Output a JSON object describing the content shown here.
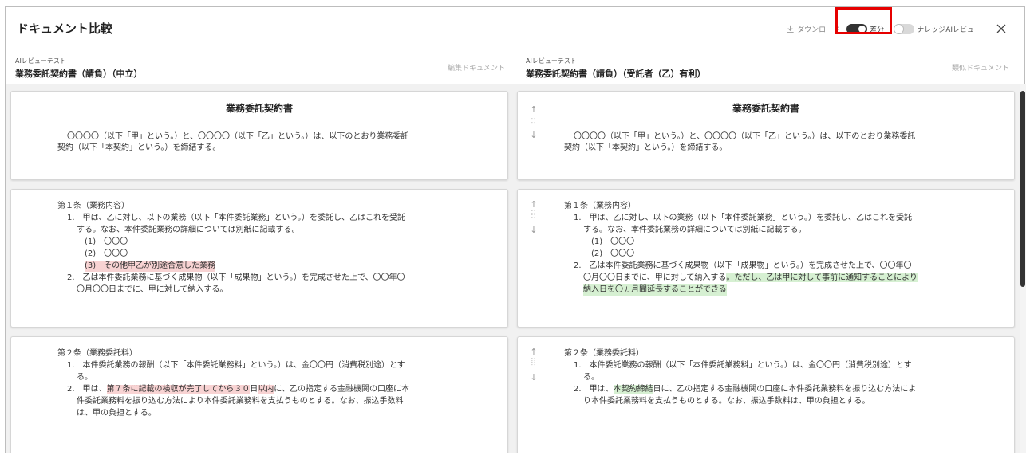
{
  "window": {
    "title": "ドキュメント比較"
  },
  "toolbar": {
    "download_label": "ダウンロード",
    "diff_label": "差分",
    "knowledge_label": "ナレッジAIレビュー",
    "diff_on": true,
    "knowledge_on": false
  },
  "left_doc": {
    "review_label": "AIレビューテスト",
    "name": "業務委託契約書（請負）（中立）",
    "tag": "編集ドキュメント"
  },
  "right_doc": {
    "review_label": "AIレビューテスト",
    "name": "業務委託契約書（請負）（受託者（乙）有利）",
    "tag": "類似ドキュメント"
  },
  "sections": {
    "s1": {
      "title": "業務委託契約書",
      "left_lines": [
        "〇〇〇〇（以下「甲」という。）と、〇〇〇〇（以下「乙」という。）は、以下のとおり業務委託",
        "契約（以下「本契約」という。）を締結する。"
      ],
      "right_lines": [
        "〇〇〇〇（以下「甲」という。）と、〇〇〇〇（以下「乙」という。）は、以下のとおり業務委託",
        "契約（以下「本契約」という。）を締結する。"
      ]
    },
    "s2": {
      "heading": "第１条（業務内容）",
      "left": {
        "l1": "1.　甲は、乙に対し、以下の業務（以下「本件委託業務」という。）を委託し、乙はこれを受託",
        "l2": "する。なお、本件委託業務の詳細については別紙に記載する。",
        "l3": "(1)　〇〇〇",
        "l4": "(2)　〇〇〇",
        "l5": "(3)　その他甲乙が別途合意した業務",
        "l6": "2.　乙は本件委託業務に基づく成果物（以下「成果物」という。）を完成させた上で、〇〇年〇",
        "l7": "〇月〇〇日までに、甲に対して納入する。"
      },
      "right": {
        "l1": "1.　甲は、乙に対し、以下の業務（以下「本件委託業務」という。）を委託し、乙はこれを受託",
        "l2": "する。なお、本件委託業務の詳細については別紙に記載する。",
        "l3": "(1)　〇〇〇",
        "l4": "(2)　〇〇〇",
        "l5": "2.　乙は本件委託業務に基づく成果物（以下「成果物」という。）を完成させた上で、〇〇年〇",
        "l6a": "〇月〇〇日までに、甲に対して納入する",
        "l6b": "。ただし、乙は甲に対して事前に通知することにより",
        "l7": "納入日を〇ヵ月間延長することができる"
      }
    },
    "s3": {
      "heading": "第２条（業務委託料）",
      "left": {
        "l1": "1.　本件委託業務の報酬（以下「本件委託業務料」という。）は、金〇〇円（消費税別途）とす",
        "l2": "る。",
        "l3a": "2.　甲は、",
        "l3b": "第７条に記載の検収が完了してから３０",
        "l3c": "日",
        "l3d": "以内",
        "l3e": "に、乙の指定する金融機関の口座に本",
        "l4": "件委託業務料を振り込む方法により本件委託業務料を支払うものとする。なお、振込手数料",
        "l5": "は、甲の負担とする。"
      },
      "right": {
        "l1": "1.　本件委託業務の報酬（以下「本件委託業務料」という。）は、金〇〇円（消費税別途）とす",
        "l2": "る。",
        "l3a": "2.　甲は、",
        "l3b": "本契約締結",
        "l3c": "日に、乙の指定する金融機関の口座に本件委託業務料を振り込む方法によ",
        "l4": "り本件委託業務料を支払うものとする。なお、振込手数料は、甲の負担とする。"
      }
    }
  },
  "colors": {
    "deleted": "#f8d3d3",
    "added": "#d6f0d2",
    "highlight": "#e60000"
  }
}
